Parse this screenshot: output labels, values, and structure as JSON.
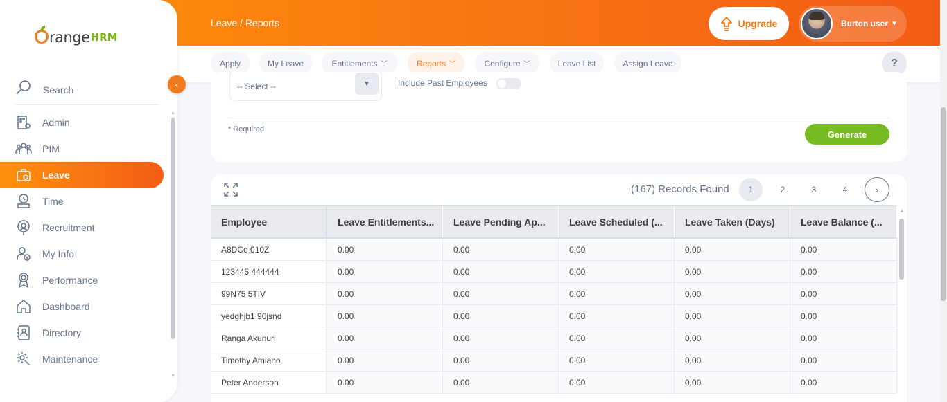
{
  "brand": {
    "name": "range",
    "suffix": "HRM"
  },
  "header": {
    "breadcrumb": "Leave / Reports",
    "upgrade_label": "Upgrade",
    "user_name": "Burton user"
  },
  "sidebar": {
    "search_label": "Search",
    "items": [
      {
        "label": "Admin",
        "icon": "admin-icon"
      },
      {
        "label": "PIM",
        "icon": "pim-icon"
      },
      {
        "label": "Leave",
        "icon": "leave-icon",
        "active": true
      },
      {
        "label": "Time",
        "icon": "time-icon"
      },
      {
        "label": "Recruitment",
        "icon": "recruitment-icon"
      },
      {
        "label": "My Info",
        "icon": "my-info-icon"
      },
      {
        "label": "Performance",
        "icon": "performance-icon"
      },
      {
        "label": "Dashboard",
        "icon": "dashboard-icon"
      },
      {
        "label": "Directory",
        "icon": "directory-icon"
      },
      {
        "label": "Maintenance",
        "icon": "maintenance-icon"
      }
    ]
  },
  "tabs": [
    {
      "label": "Apply"
    },
    {
      "label": "My Leave"
    },
    {
      "label": "Entitlements",
      "dropdown": true
    },
    {
      "label": "Reports",
      "dropdown": true,
      "active": true
    },
    {
      "label": "Configure",
      "dropdown": true
    },
    {
      "label": "Leave List"
    },
    {
      "label": "Assign Leave"
    }
  ],
  "help_label": "?",
  "filter": {
    "select_value": "-- Select --",
    "include_past_label": "Include Past Employees",
    "required_note": "* Required",
    "generate_label": "Generate"
  },
  "results": {
    "records_found": "(167) Records Found",
    "pages": [
      "1",
      "2",
      "3",
      "4"
    ],
    "current_page": "1",
    "next_label": "›",
    "columns": [
      "Employee",
      "Leave Entitlements...",
      "Leave Pending Ap...",
      "Leave Scheduled (...",
      "Leave Taken (Days)",
      "Leave Balance (..."
    ],
    "rows": [
      [
        "A8DCo 010Z",
        "0.00",
        "0.00",
        "0.00",
        "0.00",
        "0.00"
      ],
      [
        "123445 444444",
        "0.00",
        "0.00",
        "0.00",
        "0.00",
        "0.00"
      ],
      [
        "99N75 5TIV",
        "0.00",
        "0.00",
        "0.00",
        "0.00",
        "0.00"
      ],
      [
        "yedghjb1 90jsnd",
        "0.00",
        "0.00",
        "0.00",
        "0.00",
        "0.00"
      ],
      [
        "Ranga Akunuri",
        "0.00",
        "0.00",
        "0.00",
        "0.00",
        "0.00"
      ],
      [
        "Timothy Amiano",
        "0.00",
        "0.00",
        "0.00",
        "0.00",
        "0.00"
      ],
      [
        "Peter Anderson",
        "0.00",
        "0.00",
        "0.00",
        "0.00",
        "0.00"
      ]
    ]
  },
  "colors": {
    "accent": "#f27a1a",
    "accent_end": "#f35c17",
    "success": "#76bc21"
  }
}
